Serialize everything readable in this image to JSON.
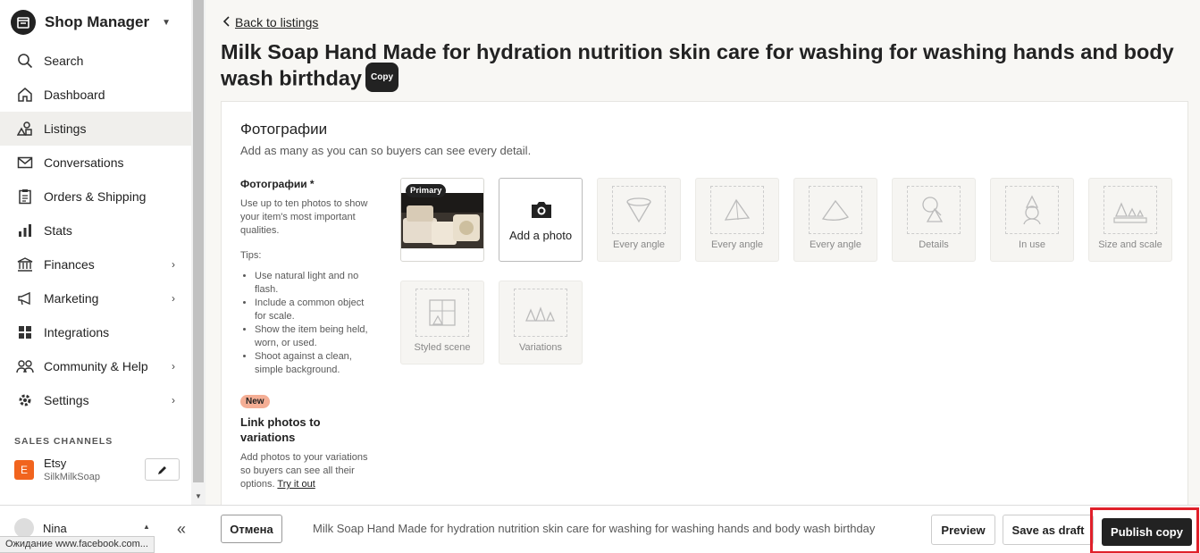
{
  "sidebar": {
    "brand": "Shop Manager",
    "items": [
      {
        "label": "Search",
        "icon": "search-icon"
      },
      {
        "label": "Dashboard",
        "icon": "home-icon"
      },
      {
        "label": "Listings",
        "icon": "shapes-icon"
      },
      {
        "label": "Conversations",
        "icon": "mail-icon"
      },
      {
        "label": "Orders & Shipping",
        "icon": "clipboard-icon"
      },
      {
        "label": "Stats",
        "icon": "bar-chart-icon"
      },
      {
        "label": "Finances",
        "icon": "bank-icon"
      },
      {
        "label": "Marketing",
        "icon": "megaphone-icon"
      },
      {
        "label": "Integrations",
        "icon": "grid-icon"
      },
      {
        "label": "Community & Help",
        "icon": "people-icon"
      },
      {
        "label": "Settings",
        "icon": "gear-icon"
      }
    ],
    "sales_channels_label": "SALES CHANNELS",
    "channel": {
      "name": "Etsy",
      "shop": "SilkMilkSoap",
      "badge": "E"
    }
  },
  "header": {
    "back_label": "Back to listings",
    "title": "Milk Soap Hand Made for hydration nutrition skin care for washing for washing hands and body wash birthday",
    "copy_badge": "Copy"
  },
  "photos": {
    "section_title": "Фотографии",
    "section_subtitle": "Add as many as you can so buyers can see every detail.",
    "field_label": "Фотографии *",
    "field_help": "Use up to ten photos to show your item's most important qualities.",
    "tips_heading": "Tips:",
    "tips": [
      "Use natural light and no flash.",
      "Include a common object for scale.",
      "Show the item being held, worn, or used.",
      "Shoot against a clean, simple background."
    ],
    "new_badge": "New",
    "link_title": "Link photos to variations",
    "link_text": "Add photos to your variations so buyers can see all their options.",
    "link_cta": "Try it out",
    "primary_badge": "Primary",
    "add_photo_label": "Add a photo",
    "placeholders": [
      "Every angle",
      "Every angle",
      "Every angle",
      "Details",
      "In use",
      "Size and scale",
      "Styled scene",
      "Variations"
    ]
  },
  "bottom": {
    "user_name": "Nina",
    "cancel_label": "Отмена",
    "listing_title": "Milk Soap Hand Made for hydration nutrition skin care for washing for washing hands and body wash birthday",
    "preview_label": "Preview",
    "draft_label": "Save as draft",
    "publish_label": "Publish copy"
  },
  "status_bar": "Ожидание www.facebook.com...",
  "colors": {
    "accent": "#222222",
    "etsy_orange": "#f1641e",
    "highlight": "#e0202a",
    "new_badge": "#f4ae95"
  }
}
